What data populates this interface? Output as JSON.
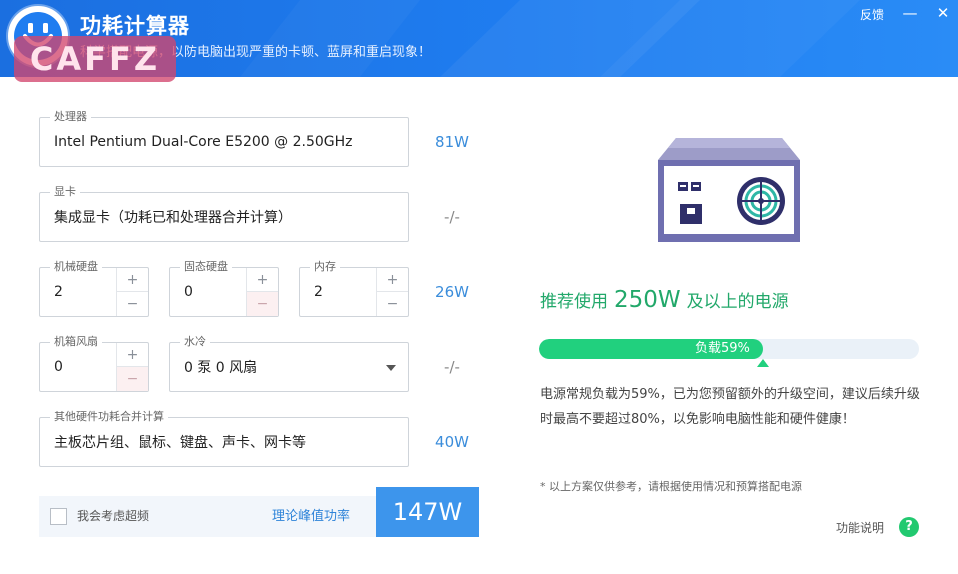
{
  "header": {
    "title": "功耗计算器",
    "subtitle": "科学搭配电源，以防电脑出现严重的卡顿、蓝屏和重启现象！",
    "feedback": "反馈",
    "minimize": "—",
    "close": "✕",
    "watermark": "CAFFZ"
  },
  "fields": {
    "cpu": {
      "label": "处理器",
      "value": "Intel Pentium Dual-Core E5200 @ 2.50GHz",
      "watt": "81W"
    },
    "gpu": {
      "label": "显卡",
      "value": "集成显卡（功耗已和处理器合并计算）",
      "watt": "-/-"
    },
    "hdd": {
      "label": "机械硬盘",
      "value": "2"
    },
    "ssd": {
      "label": "固态硬盘",
      "value": "0"
    },
    "ram": {
      "label": "内存",
      "value": "2"
    },
    "storage_watt": "26W",
    "fan": {
      "label": "机箱风扇",
      "value": "0"
    },
    "water": {
      "label": "水冷",
      "value": "0 泵 0 风扇"
    },
    "cooling_watt": "-/-",
    "other": {
      "label": "其他硬件功耗合并计算",
      "value": "主板芯片组、鼠标、键盘、声卡、网卡等",
      "watt": "40W"
    }
  },
  "stepper": {
    "plus": "+",
    "minus": "−"
  },
  "bottom": {
    "overclock_label": "我会考虑超频",
    "peak_label": "理论峰值功率",
    "peak_value": "147W"
  },
  "recommend": {
    "prefix": "推荐使用",
    "watt": "250W",
    "suffix": "及以上的电源"
  },
  "load": {
    "label": "负载59%",
    "fraction": 0.59
  },
  "description": "电源常规负载为59%，已为您预留额外的升级空间，建议后续升级时最高不要超过80%，以免影响电脑性能和硬件健康！",
  "note": "* 以上方案仅供参考，请根据使用情况和预算搭配电源",
  "help": {
    "label": "功能说明",
    "icon": "?"
  },
  "colors": {
    "accent": "#1f7df0",
    "green": "#21d07e",
    "watt_blue": "#3b8ddb"
  }
}
